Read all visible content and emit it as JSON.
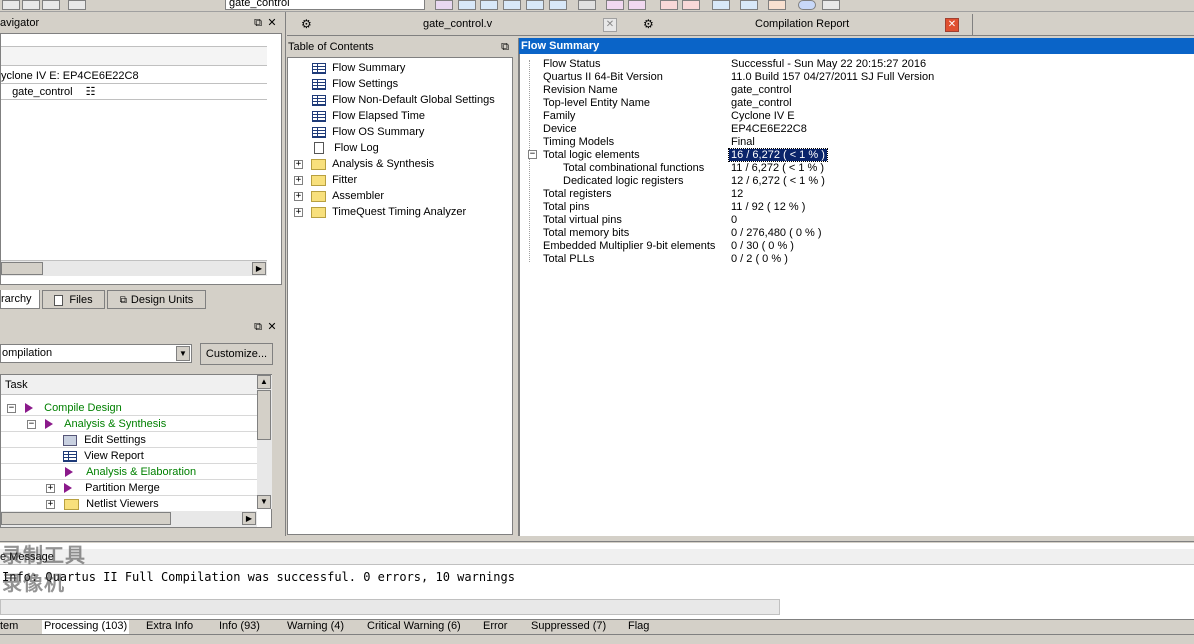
{
  "toolbar": {
    "entity_select_value": "gate_control"
  },
  "project_navigator": {
    "title": "avigator",
    "device_row": "yclone IV E: EP4CE6E22C8",
    "top_entity": "gate_control",
    "tabs": [
      "rarchy",
      "Files",
      "Design Units"
    ]
  },
  "tasks": {
    "flow_value": "ompilation",
    "customize_label": "Customize...",
    "column_header": "Task",
    "items": [
      {
        "label": "Compile Design",
        "color": "#008000"
      },
      {
        "label": "Analysis & Synthesis",
        "color": "#008000"
      },
      {
        "label": "Edit Settings",
        "color": "#000000"
      },
      {
        "label": "View Report",
        "color": "#000000"
      },
      {
        "label": "Analysis & Elaboration",
        "color": "#008000"
      },
      {
        "label": "Partition Merge",
        "color": "#000000"
      },
      {
        "label": "Netlist Viewers",
        "color": "#000000"
      }
    ]
  },
  "doc_tabs": {
    "file_tab": "gate_control.v",
    "report_tab": "Compilation Report"
  },
  "toc": {
    "title": "Table of Contents",
    "items": [
      {
        "label": "Flow Summary",
        "icon": "table-icon"
      },
      {
        "label": "Flow Settings",
        "icon": "table-icon"
      },
      {
        "label": "Flow Non-Default Global Settings",
        "icon": "table-icon"
      },
      {
        "label": "Flow Elapsed Time",
        "icon": "table-icon"
      },
      {
        "label": "Flow OS Summary",
        "icon": "table-icon"
      },
      {
        "label": "Flow Log",
        "icon": "document-icon"
      },
      {
        "label": "Analysis & Synthesis",
        "icon": "folder-icon"
      },
      {
        "label": "Fitter",
        "icon": "folder-icon"
      },
      {
        "label": "Assembler",
        "icon": "folder-icon"
      },
      {
        "label": "TimeQuest Timing Analyzer",
        "icon": "folder-icon"
      }
    ]
  },
  "flow_summary": {
    "title": "Flow Summary",
    "rows": [
      {
        "label": "Flow Status",
        "value": "Successful - Sun May 22 20:15:27 2016"
      },
      {
        "label": "Quartus II 64-Bit Version",
        "value": "11.0 Build 157 04/27/2011 SJ Full Version"
      },
      {
        "label": "Revision Name",
        "value": "gate_control"
      },
      {
        "label": "Top-level Entity Name",
        "value": "gate_control"
      },
      {
        "label": "Family",
        "value": "Cyclone IV E"
      },
      {
        "label": "Device",
        "value": "EP4CE6E22C8"
      },
      {
        "label": "Timing Models",
        "value": "Final"
      },
      {
        "label": "Total logic elements",
        "value": "16 / 6,272 ( < 1 % )"
      },
      {
        "label": "Total combinational functions",
        "value": "11 / 6,272 ( < 1 % )"
      },
      {
        "label": "Dedicated logic registers",
        "value": "12 / 6,272 ( < 1 % )"
      },
      {
        "label": "Total registers",
        "value": "12"
      },
      {
        "label": "Total pins",
        "value": "11 / 92 ( 12 % )"
      },
      {
        "label": "Total virtual pins",
        "value": "0"
      },
      {
        "label": "Total memory bits",
        "value": "0 / 276,480 ( 0 % )"
      },
      {
        "label": "Embedded Multiplier 9-bit elements",
        "value": "0 / 30 ( 0 % )"
      },
      {
        "label": "Total PLLs",
        "value": "0 / 2 ( 0 % )"
      }
    ]
  },
  "messages": {
    "header": "e  Message",
    "line": "Info: Quartus II Full Compilation was successful. 0 errors, 10 warnings",
    "watermark": "录制工具 录像机",
    "tabs": [
      "tem",
      "Processing (103)",
      "Extra Info",
      "Info (93)",
      "Warning (4)",
      "Critical Warning (6)",
      "Error",
      "Suppressed (7)",
      "Flag"
    ]
  },
  "colors": {
    "selection": "#0a246a",
    "report_header": "#0a64c8",
    "tree_green": "#008000",
    "task_arrow": "#8b1a8b"
  }
}
